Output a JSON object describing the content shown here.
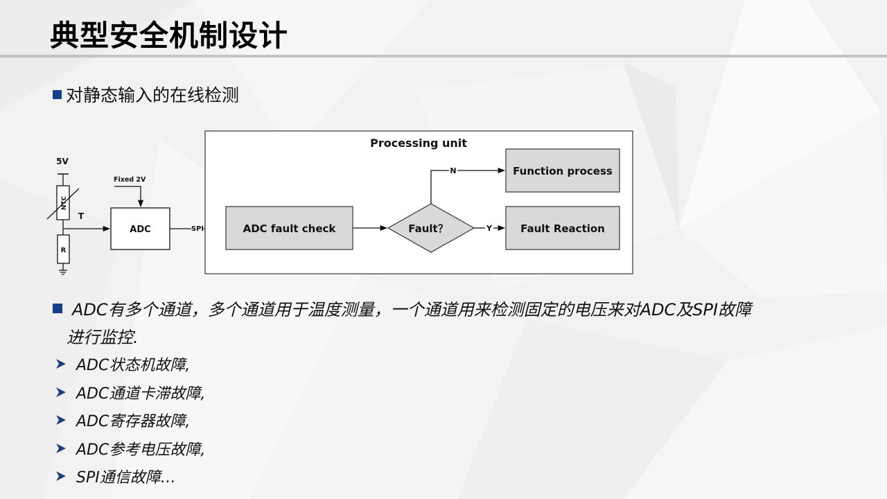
{
  "slide": {
    "title": "典型安全机制设计",
    "section_heading": "对静态输入的在线检测",
    "accent_color": "#163f8a",
    "rule_color": "#c3c3c3"
  },
  "diagram": {
    "supply_label": "5V",
    "ntc_label": "NTC",
    "resistor_label": "R",
    "signal_label": "T",
    "reference_label": "Fixed 2V",
    "adc_label": "ADC",
    "bus_label": "SPI",
    "container_title": "Processing unit",
    "check_box_label": "ADC fault check",
    "decision_label": "Fault？",
    "no_label": "N",
    "yes_label": "Y",
    "function_box_label": "Function process",
    "reaction_box_label": "Fault Reaction",
    "box_fill": "#d9d9d9"
  },
  "description": {
    "line1": "ADC有多个通道，多个通道用于温度测量，一个通道用来检测固定的电压来对ADC及SPI故障",
    "line2": "进行监控."
  },
  "sub_items": [
    {
      "icon": "arrow-bullet-icon",
      "label": "ADC状态机故障,"
    },
    {
      "icon": "arrow-bullet-icon",
      "label": "ADC通道卡滞故障,"
    },
    {
      "icon": "arrow-bullet-icon",
      "label": "ADC寄存器故障,"
    },
    {
      "icon": "arrow-bullet-icon",
      "label": "ADC参考电压故障,"
    },
    {
      "icon": "arrow-bullet-icon",
      "label": "SPI通信故障…"
    }
  ]
}
